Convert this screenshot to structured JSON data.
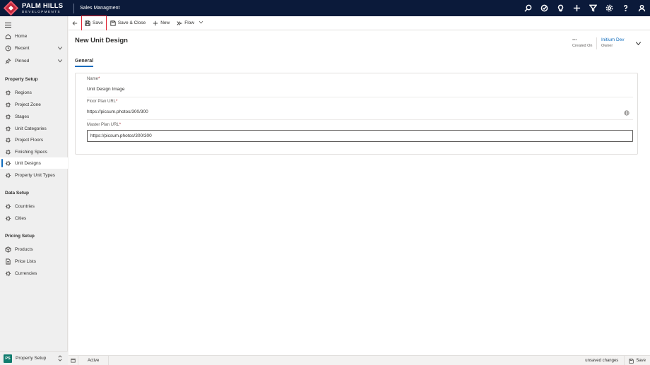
{
  "brand": {
    "name_line1": "PALM HILLS",
    "name_line2": "DEVELOPMENTS",
    "logo_color": "#c2253a"
  },
  "app": {
    "title": "Sales Managment"
  },
  "top_icons": [
    "search-icon",
    "task-check-icon",
    "lightbulb-icon",
    "plus-icon",
    "filter-icon",
    "gear-icon",
    "help-icon",
    "user-icon"
  ],
  "sidebar": {
    "top_items": [
      {
        "label": "Home",
        "icon": "home-icon"
      },
      {
        "label": "Recent",
        "icon": "clock-icon",
        "expandable": true
      },
      {
        "label": "Pinned",
        "icon": "pin-icon",
        "expandable": true
      }
    ],
    "sections": [
      {
        "title": "Property Setup",
        "items": [
          {
            "label": "Regions"
          },
          {
            "label": "Project Zone"
          },
          {
            "label": "Stages"
          },
          {
            "label": "Unit Categories"
          },
          {
            "label": "Project Floors"
          },
          {
            "label": "Finishing Specs"
          },
          {
            "label": "Unit Designs",
            "active": true
          },
          {
            "label": "Property Unit Types"
          }
        ]
      },
      {
        "title": "Data Setup",
        "items": [
          {
            "label": "Countries"
          },
          {
            "label": "Cities"
          }
        ]
      },
      {
        "title": "Pricing Setup",
        "items": [
          {
            "label": "Products"
          },
          {
            "label": "Price Lists"
          },
          {
            "label": "Currencies"
          }
        ]
      }
    ],
    "area": {
      "badge": "PS",
      "label": "Property Setup"
    }
  },
  "commands": {
    "save": "Save",
    "save_close": "Save & Close",
    "new": "New",
    "flow": "Flow"
  },
  "form": {
    "title": "New Unit Design",
    "header": {
      "created_on_value": "---",
      "created_on_label": "Created On",
      "owner_value": "Initium Dev",
      "owner_label": "Owner"
    },
    "tab": "General",
    "fields": {
      "name_label": "Name",
      "name_value": "Unit Design Image",
      "floor_plan_label": "Floor Plan URL",
      "floor_plan_value": "https://picsum.photos/300/300",
      "master_plan_label": "Master Plan URL",
      "master_plan_value": "https://picsum.photos/300/300",
      "required_marker": "*"
    }
  },
  "statusbar": {
    "status": "Active",
    "unsaved": "unsaved changes",
    "save": "Save"
  },
  "colors": {
    "topbar": "#0b1a3a",
    "accent": "#0f6cbd",
    "highlight": "#e0202f",
    "area_badge": "#107c6e"
  }
}
